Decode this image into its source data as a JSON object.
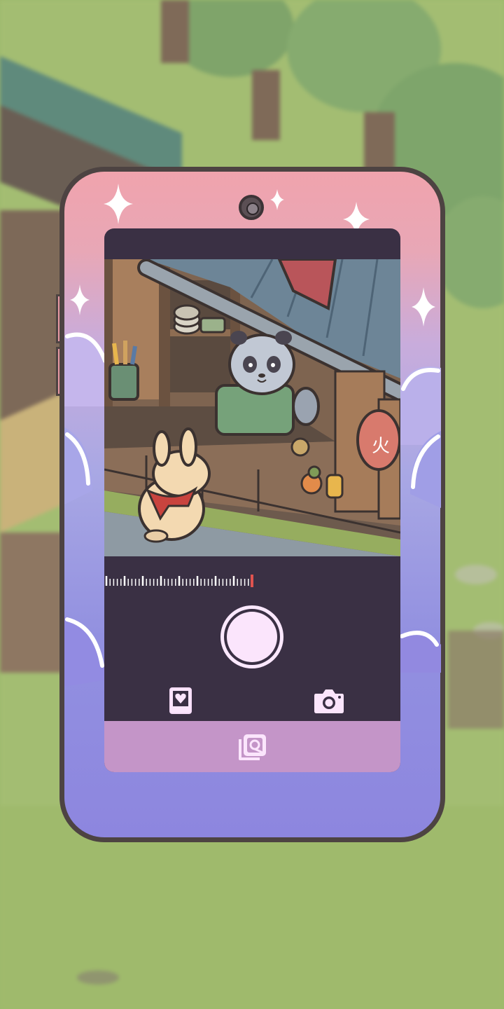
{
  "screen": {
    "name": "camera-app",
    "icons": {
      "front_camera": "camera-lens-icon",
      "shutter": "shutter-button",
      "gallery": "photo-heart-icon",
      "switch_camera": "camera-icon",
      "album": "photo-album-icon"
    },
    "zoom_level": 1.0,
    "colors": {
      "phone_frame": "#4d4342",
      "phone_top": "#f0a3ad",
      "phone_bottom": "#8d86df",
      "screen_bg": "#3a3044",
      "bottom_bar": "#c495c8",
      "shutter": "#fbe5fc",
      "zoom_marker": "#e0534f"
    }
  },
  "scene": {
    "sign_text": "火",
    "characters": [
      "panda-shopkeeper",
      "rabbit-with-red-scarf"
    ]
  }
}
